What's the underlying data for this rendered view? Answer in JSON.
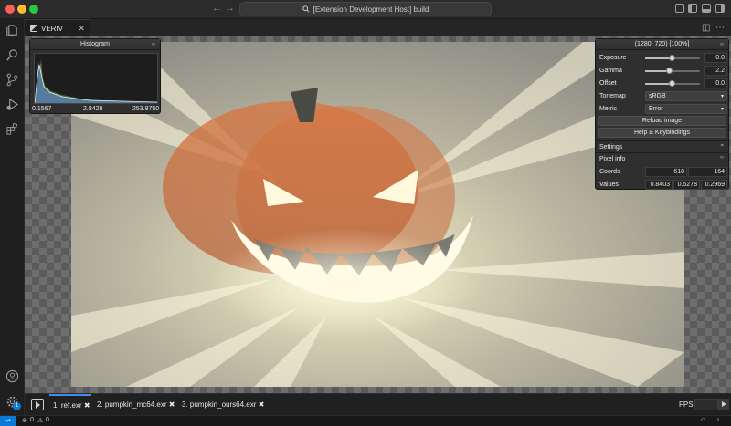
{
  "window": {
    "title": "[Extension Development Host] build",
    "search_icon": "search-icon"
  },
  "editor": {
    "tab_title": "VERIV",
    "tab_close": "✕",
    "split_icon": "split-editor-icon",
    "more_icon": "⋯"
  },
  "histogram": {
    "title": "Histogram",
    "ticks": [
      "0.1567",
      "2.8428",
      "253.8750"
    ],
    "colors": {
      "red": "#d84c3c",
      "green": "#4bb54b",
      "blue": "#4a7de0",
      "lum": "#e8e8e8"
    }
  },
  "controls": {
    "header": "(1280, 720) [100%]",
    "exposure": {
      "label": "Exposure",
      "value": "0.0",
      "fraction": 0.5
    },
    "gamma": {
      "label": "Gamma",
      "value": "2.2",
      "fraction": 0.45
    },
    "offset": {
      "label": "Offset",
      "value": "0.0",
      "fraction": 0.5
    },
    "tonemap": {
      "label": "Tonemap",
      "selected": "sRGB"
    },
    "metric": {
      "label": "Metric",
      "selected": "Error"
    },
    "reload_label": "Reload image",
    "help_label": "Help & Keybindings",
    "settings_label": "Settings",
    "settings_icon": "=",
    "pixel_info_label": "Pixel info",
    "pixel_info_icon": "‹›",
    "coords": {
      "label": "Coords",
      "x": "618",
      "y": "164"
    },
    "values": {
      "label": "Values",
      "r": "0.8403",
      "g": "0.5278",
      "b": "0.2969"
    }
  },
  "files": [
    {
      "label": "1. ref.exr",
      "close": "✖",
      "active": true
    },
    {
      "label": "2. pumpkin_mc64.exr",
      "close": "✖",
      "active": false
    },
    {
      "label": "3. pumpkin_ours64.exr",
      "close": "✖",
      "active": false
    }
  ],
  "fps_label": "FPS:",
  "status": {
    "errors": "0",
    "warnings": "0",
    "accounts_badge": "1"
  },
  "accent_color": "#0a7ad6"
}
